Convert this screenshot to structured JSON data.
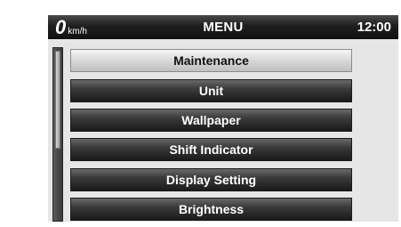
{
  "header": {
    "speed_value": "0",
    "speed_unit": "km/h",
    "title": "MENU",
    "clock": "12:00"
  },
  "menu": {
    "items": [
      {
        "label": "Maintenance",
        "selected": true
      },
      {
        "label": "Unit",
        "selected": false
      },
      {
        "label": "Wallpaper",
        "selected": false
      },
      {
        "label": "Shift Indicator",
        "selected": false
      },
      {
        "label": "Display Setting",
        "selected": false
      },
      {
        "label": "Brightness",
        "selected": false
      }
    ]
  },
  "colors": {
    "header_bg": "#1e1e1e",
    "item_bg": "#2a2a2a",
    "selected_bg": "#d8d8d8",
    "screen_bg": "#e6e6e6"
  }
}
